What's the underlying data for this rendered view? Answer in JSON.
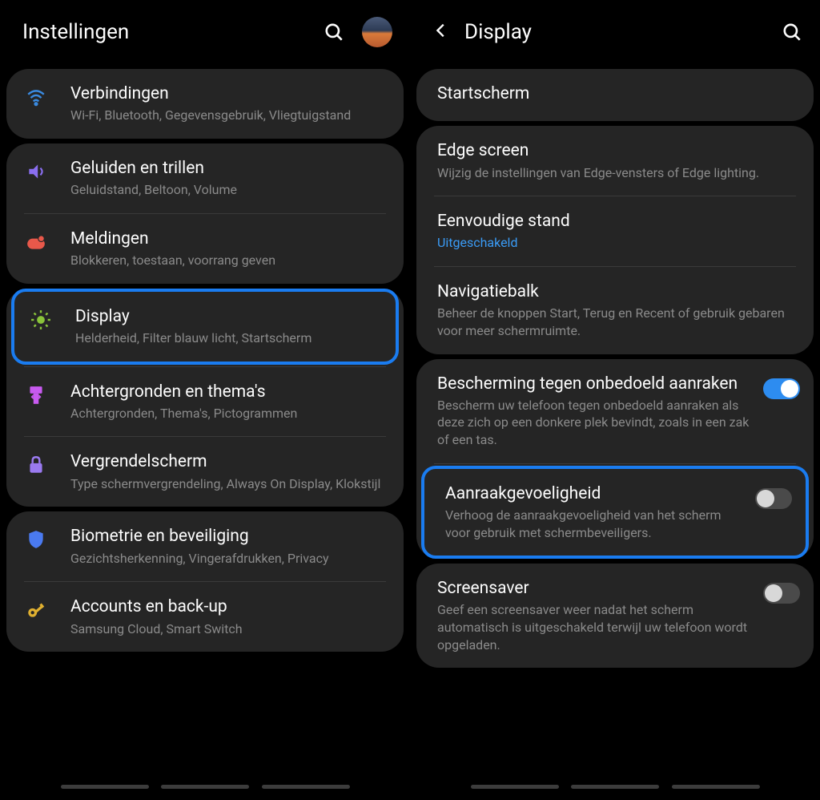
{
  "left": {
    "title": "Instellingen",
    "sections": [
      {
        "items": [
          {
            "icon": "wifi",
            "color": "#3a8ae0",
            "title": "Verbindingen",
            "sub": "Wi-Fi, Bluetooth, Gegevensgebruik, Vliegtuigstand"
          }
        ]
      },
      {
        "items": [
          {
            "icon": "sound",
            "color": "#8a6ef0",
            "title": "Geluiden en trillen",
            "sub": "Geluidstand, Beltoon, Volume"
          },
          {
            "icon": "notif",
            "color": "#e8584a",
            "title": "Meldingen",
            "sub": "Blokkeren, toestaan, voorrang geven"
          }
        ]
      },
      {
        "items": [
          {
            "icon": "display",
            "color": "#8ac43a",
            "title": "Display",
            "sub": "Helderheid, Filter blauw licht, Startscherm",
            "highlight": true
          },
          {
            "icon": "themes",
            "color": "#c85af0",
            "title": "Achtergronden en thema's",
            "sub": "Achtergronden, Thema's, Pictogrammen"
          },
          {
            "icon": "lock",
            "color": "#9a7af0",
            "title": "Vergrendelscherm",
            "sub": "Type schermvergrendeling, Always On Display, Klokstijl"
          }
        ]
      },
      {
        "items": [
          {
            "icon": "shield",
            "color": "#4a7af0",
            "title": "Biometrie en beveiliging",
            "sub": "Gezichtsherkenning, Vingerafdrukken, Privacy"
          },
          {
            "icon": "key",
            "color": "#e0b030",
            "title": "Accounts en back-up",
            "sub": "Samsung Cloud, Smart Switch"
          }
        ]
      }
    ]
  },
  "right": {
    "title": "Display",
    "sections": [
      {
        "items": [
          {
            "title": "Startscherm",
            "sub": ""
          }
        ]
      },
      {
        "items": [
          {
            "title": "Edge screen",
            "sub": "Wijzig de instellingen van Edge-vensters of Edge lighting."
          },
          {
            "title": "Eenvoudige stand",
            "sub": "Uitgeschakeld",
            "subLink": true
          },
          {
            "title": "Navigatiebalk",
            "sub": "Beheer de knoppen Start, Terug en Recent of gebruik gebaren voor meer schermruimte."
          }
        ]
      },
      {
        "items": [
          {
            "title": "Bescherming tegen onbedoeld aanraken",
            "sub": "Bescherm uw telefoon tegen onbedoeld aanraken als deze zich op een donkere plek bevindt, zoals in een zak of een tas.",
            "toggle": true,
            "on": true
          },
          {
            "title": "Aanraakgevoeligheid",
            "sub": "Verhoog de aanraakgevoeligheid van het scherm voor gebruik met schermbeveiligers.",
            "toggle": true,
            "on": false,
            "highlight": true
          }
        ]
      },
      {
        "items": [
          {
            "title": "Screensaver",
            "sub": "Geef een screensaver weer nadat het scherm automatisch is uitgeschakeld terwijl uw telefoon wordt opgeladen.",
            "toggle": true,
            "on": false
          }
        ]
      }
    ]
  }
}
